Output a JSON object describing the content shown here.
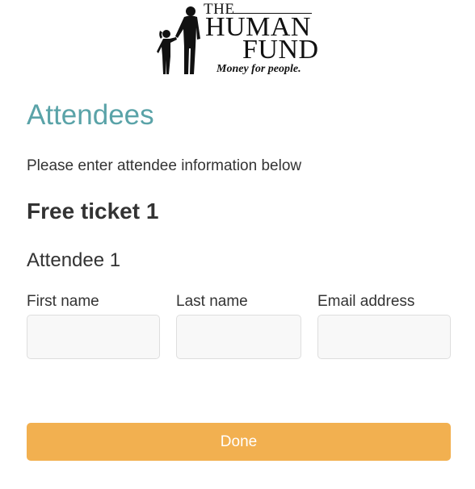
{
  "logo": {
    "line1": "THE",
    "line2": "HUMAN",
    "line3": "FUND",
    "tagline": "Money for people."
  },
  "page_title": "Attendees",
  "instructions": "Please enter attendee information below",
  "ticket_title": "Free ticket 1",
  "attendee_title": "Attendee 1",
  "form": {
    "first_name_label": "First name",
    "first_name_value": "",
    "last_name_label": "Last name",
    "last_name_value": "",
    "email_label": "Email address",
    "email_value": ""
  },
  "done_label": "Done",
  "colors": {
    "title": "#5aa3a8",
    "button": "#f2b050",
    "input_bg": "#f8f8f8"
  }
}
